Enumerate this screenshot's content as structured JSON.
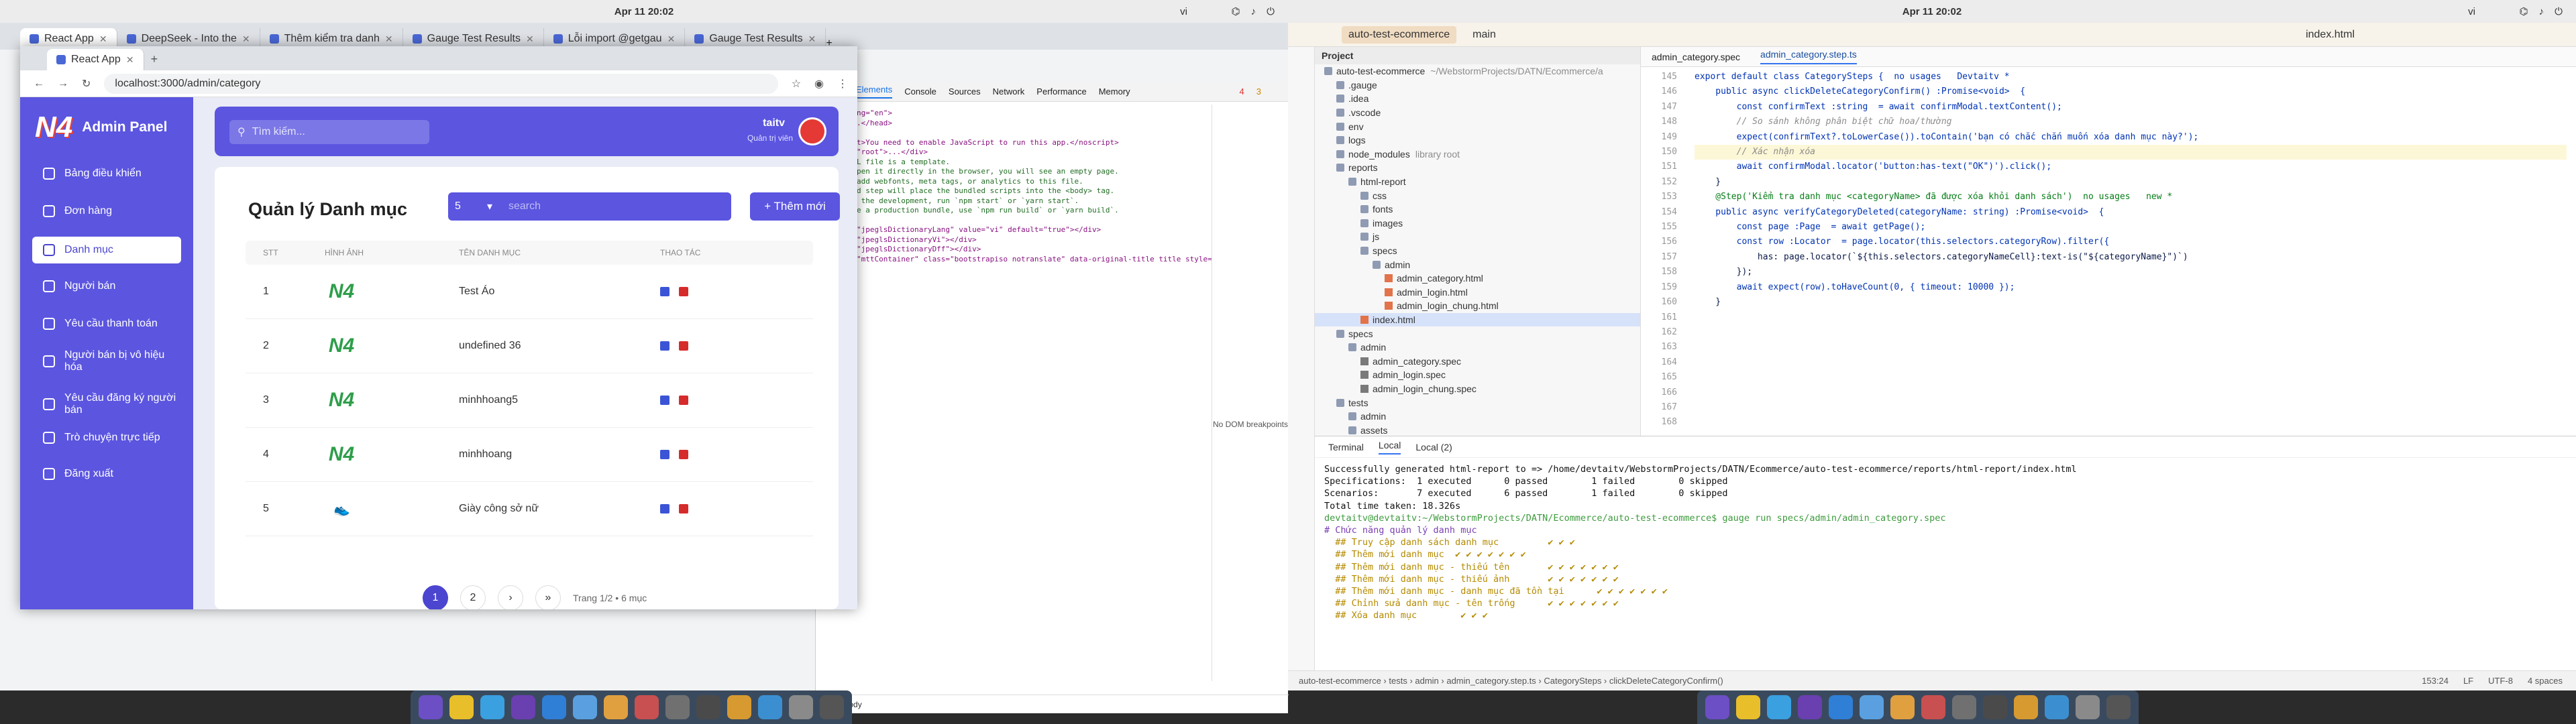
{
  "system": {
    "clock": "Apr 11  20:02",
    "lang": "vi",
    "clock_right": "Apr 11  20:02",
    "lang_right": "vi"
  },
  "bg_browser": {
    "tabs": [
      "React App",
      "DeepSeek - Into the",
      "Thêm kiểm tra danh",
      "Gauge Test Results",
      "Lỗi import @getgau",
      "Gauge Test Results"
    ],
    "devtools": {
      "tabs": [
        "Elements",
        "Console",
        "Sources",
        "Network",
        "Performance",
        "Memory"
      ],
      "errors": "4",
      "warnings": "3",
      "breadcrumb": [
        "html",
        "body"
      ],
      "side_note": "No DOM breakpoints",
      "code_lines": [
        "<html lang=\"en\">",
        "<head>...</head>",
        "<body>",
        "<noscript>You need to enable JavaScript to run this app.</noscript>",
        "<div id=\"root\">...</div>",
        "",
        "This HTML file is a template.",
        "If you open it directly in the browser, you will see an empty page.",
        "",
        "You can add webfonts, meta tags, or analytics to this file.",
        "The build step will place the bundled scripts into the <body> tag.",
        "",
        "To begin the development, run `npm start` or `yarn start`.",
        "To create a production bundle, use `npm run build` or `yarn build`.",
        "-->",
        "<div id=\"jpeglsDictionaryLang\" value=\"vi\" default=\"true\"></div>",
        "<div id=\"jpeglsDictionaryVi\"></div>",
        "<div id=\"jpeglsDictionaryDff\"></div>",
        "<div id=\"mttContainer\" class=\"bootstrapiso notranslate\" data-original-title title style=\"transform: translate(97px, 290px);\"></div>",
        "</body>",
        "</html>"
      ]
    }
  },
  "fg_browser": {
    "tab_title": "React App",
    "url": "localhost:3000/admin/category",
    "sidebar": {
      "logo_mark": "N4",
      "logo_text": "Admin Panel",
      "items": [
        {
          "label": "Bảng điều khiển",
          "icon": "dashboard-icon"
        },
        {
          "label": "Đơn hàng",
          "icon": "cart-icon"
        },
        {
          "label": "Danh mục",
          "icon": "category-icon",
          "active": true
        },
        {
          "label": "Người bán",
          "icon": "user-icon"
        },
        {
          "label": "Yêu cầu thanh toán",
          "icon": "payment-icon"
        },
        {
          "label": "Người bán bị vô hiệu hóa",
          "icon": "user-block-icon"
        },
        {
          "label": "Yêu cầu đăng ký người bán",
          "icon": "user-add-icon"
        },
        {
          "label": "Trò chuyện trực tiếp",
          "icon": "chat-icon"
        },
        {
          "label": "Đăng xuất",
          "icon": "logout-icon"
        }
      ]
    },
    "header": {
      "search_placeholder": "Tìm kiếm...",
      "user_name": "taitv",
      "user_role": "Quản trị viên"
    },
    "card": {
      "title": "Quản lý Danh mục",
      "page_size": "5",
      "search_placeholder": "search",
      "add_label": "+ Thêm mới",
      "columns": [
        "STT",
        "HÌNH ẢNH",
        "TÊN DANH MỤC",
        "THAO TÁC"
      ],
      "rows": [
        {
          "stt": "1",
          "name": "Test Áo",
          "img": "logo"
        },
        {
          "stt": "2",
          "name": "undefined 36",
          "img": "logo"
        },
        {
          "stt": "3",
          "name": "minhhoang5",
          "img": "logo"
        },
        {
          "stt": "4",
          "name": "minhhoang",
          "img": "logo"
        },
        {
          "stt": "5",
          "name": "Giày công sở nữ",
          "img": "shoe"
        }
      ],
      "pager": {
        "pages": [
          "1",
          "2"
        ],
        "next": "›",
        "last": "»",
        "info": "Trang 1/2 • 6 mục"
      }
    }
  },
  "ide": {
    "project_name": "auto-test-ecommerce",
    "branch": "main",
    "run_config": "index.html",
    "tree_title": "Project",
    "tree": [
      {
        "d": 0,
        "t": "folder",
        "label": "auto-test-ecommerce",
        "hint": "~/WebstormProjects/DATN/Ecommerce/a"
      },
      {
        "d": 1,
        "t": "folder",
        "label": ".gauge"
      },
      {
        "d": 1,
        "t": "folder",
        "label": ".idea"
      },
      {
        "d": 1,
        "t": "folder",
        "label": ".vscode"
      },
      {
        "d": 1,
        "t": "folder",
        "label": "env"
      },
      {
        "d": 1,
        "t": "folder",
        "label": "logs"
      },
      {
        "d": 1,
        "t": "folder",
        "label": "node_modules",
        "hint": "library root"
      },
      {
        "d": 1,
        "t": "folder",
        "label": "reports"
      },
      {
        "d": 2,
        "t": "folder",
        "label": "html-report"
      },
      {
        "d": 3,
        "t": "folder",
        "label": "css"
      },
      {
        "d": 3,
        "t": "folder",
        "label": "fonts"
      },
      {
        "d": 3,
        "t": "folder",
        "label": "images"
      },
      {
        "d": 3,
        "t": "folder",
        "label": "js"
      },
      {
        "d": 3,
        "t": "folder",
        "label": "specs"
      },
      {
        "d": 4,
        "t": "folder",
        "label": "admin"
      },
      {
        "d": 5,
        "t": "html",
        "label": "admin_category.html"
      },
      {
        "d": 5,
        "t": "html",
        "label": "admin_login.html"
      },
      {
        "d": 5,
        "t": "html",
        "label": "admin_login_chung.html"
      },
      {
        "d": 3,
        "t": "html",
        "label": "index.html",
        "sel": true
      },
      {
        "d": 1,
        "t": "folder",
        "label": "specs"
      },
      {
        "d": 2,
        "t": "folder",
        "label": "admin"
      },
      {
        "d": 3,
        "t": "spec",
        "label": "admin_category.spec"
      },
      {
        "d": 3,
        "t": "spec",
        "label": "admin_login.spec"
      },
      {
        "d": 3,
        "t": "spec",
        "label": "admin_login_chung.spec"
      },
      {
        "d": 1,
        "t": "folder",
        "label": "tests"
      },
      {
        "d": 2,
        "t": "folder",
        "label": "admin"
      },
      {
        "d": 2,
        "t": "folder",
        "label": "assets"
      }
    ],
    "editor_tabs": [
      "admin_category.spec",
      "admin_category.step.ts"
    ],
    "line_numbers": [
      "145",
      "146",
      "147",
      "148",
      "149",
      "150",
      "151",
      "152",
      "153",
      "154",
      "155",
      "156",
      "157",
      "158",
      "159",
      "160",
      "161",
      "162",
      "163",
      "164",
      "165",
      "166",
      "167",
      "168"
    ],
    "code": [
      "export default class CategorySteps {  no usages   Devtaitv *",
      "    public async clickDeleteCategoryConfirm() :Promise<void>  {",
      "",
      "        const confirmText :string  = await confirmModal.textContent();",
      "",
      "        // So sánh không phân biệt chữ hoa/thường",
      "        expect(confirmText?.toLowerCase()).toContain('bạn có chắc chắn muốn xóa danh mục này?');",
      "",
      "        // Xác nhận xóa",
      "        await confirmModal.locator('button:has-text(\"OK\")').click();",
      "    }",
      "",
      "    @Step('Kiểm tra danh mục <categoryName> đã được xóa khỏi danh sách')  no usages   new *",
      "    public async verifyCategoryDeleted(categoryName: string) :Promise<void>  {",
      "        const page :Page  = await getPage();",
      "",
      "        const row :Locator  = page.locator(this.selectors.categoryRow).filter({",
      "            has: page.locator(`${this.selectors.categoryNameCell}:text-is(\"${categoryName}\")`)",
      "        });",
      "",
      "        await expect(row).toHaveCount(0, { timeout: 10000 });",
      "    }",
      "",
      ""
    ],
    "terminal": {
      "tabs": [
        "Terminal",
        "Local",
        "Local (2)"
      ],
      "lines": [
        {
          "c": "",
          "t": "Successfully generated html-report to => /home/devtaitv/WebstormProjects/DATN/Ecommerce/auto-test-ecommerce/reports/html-report/index.html"
        },
        {
          "c": "",
          "t": ""
        },
        {
          "c": "",
          "t": "Specifications:  1 executed      0 passed        1 failed        0 skipped"
        },
        {
          "c": "",
          "t": "Scenarios:       7 executed      6 passed        1 failed        0 skipped"
        },
        {
          "c": "",
          "t": ""
        },
        {
          "c": "",
          "t": "Total time taken: 18.326s"
        },
        {
          "c": "tg",
          "t": "devtaitv@devtaitv:~/WebstormProjects/DATN/Ecommerce/auto-test-ecommerce$ gauge run specs/admin/admin_category.spec"
        },
        {
          "c": "tp",
          "t": "# Chức năng quản lý danh mục"
        },
        {
          "c": "ty",
          "t": "  ## Truy cập danh sách danh mục         ✔ ✔ ✔"
        },
        {
          "c": "ty",
          "t": "  ## Thêm mới danh mục  ✔ ✔ ✔ ✔ ✔ ✔ ✔"
        },
        {
          "c": "ty",
          "t": "  ## Thêm mới danh mục - thiếu tên       ✔ ✔ ✔ ✔ ✔ ✔ ✔"
        },
        {
          "c": "ty",
          "t": "  ## Thêm mới danh mục - thiếu ảnh       ✔ ✔ ✔ ✔ ✔ ✔ ✔"
        },
        {
          "c": "ty",
          "t": "  ## Thêm mới danh mục - danh mục đã tồn tại      ✔ ✔ ✔ ✔ ✔ ✔ ✔"
        },
        {
          "c": "ty",
          "t": "  ## Chỉnh sửa danh mục - tên trống      ✔ ✔ ✔ ✔ ✔ ✔ ✔"
        },
        {
          "c": "ty",
          "t": "  ## Xóa danh mục        ✔ ✔ ✔"
        }
      ]
    },
    "status": {
      "breadcrumb": "auto-test-ecommerce  ›  tests  ›  admin  ›  admin_category.step.ts  ›  CategorySteps  ›  clickDeleteCategoryConfirm()",
      "position": "153:24",
      "line_sep": "LF",
      "encoding": "UTF-8",
      "indent": "4 spaces"
    }
  }
}
